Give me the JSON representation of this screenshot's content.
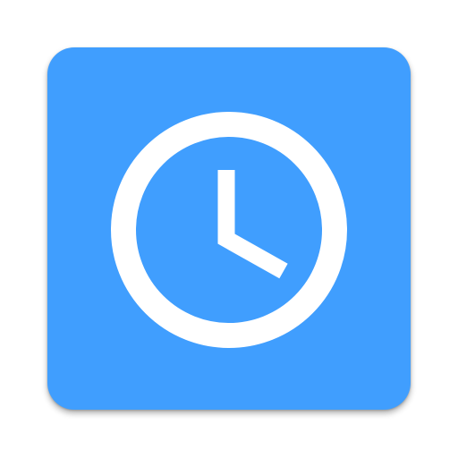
{
  "app_icon": {
    "icon": "clock-icon",
    "colors": {
      "tile_background": "#409efe",
      "glyph": "#ffffff"
    }
  }
}
